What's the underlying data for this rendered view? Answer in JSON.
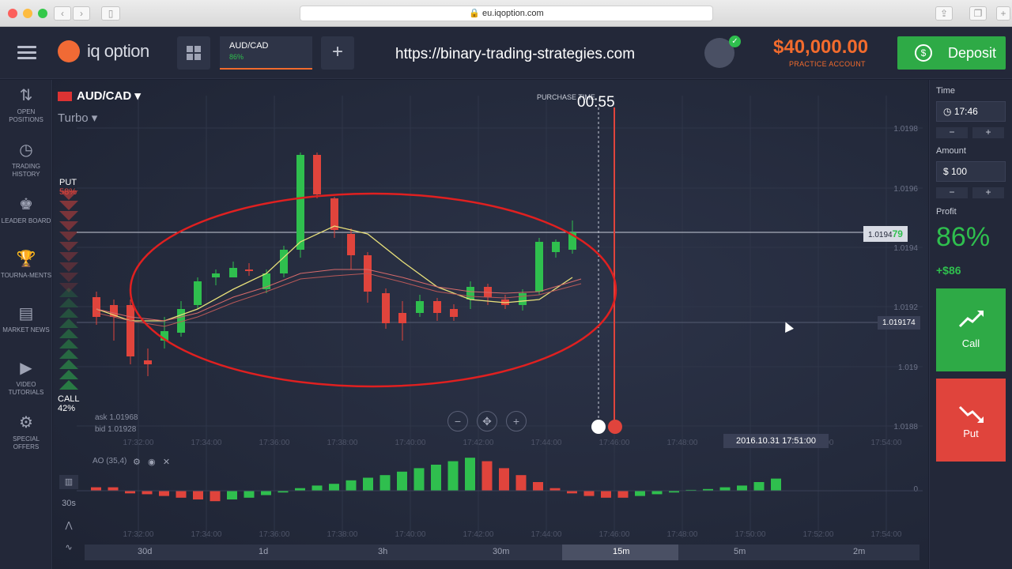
{
  "browser": {
    "url": "eu.iqoption.com"
  },
  "header": {
    "logo": "iq option",
    "asset_tab": {
      "name": "AUD/CAD",
      "pct": "86%"
    },
    "plus": "+",
    "watermark_url": "https://binary-trading-strategies.com",
    "balance": "$40,000.00",
    "balance_sub": "PRACTICE ACCOUNT",
    "deposit": "Deposit"
  },
  "sidebar": {
    "items": [
      {
        "icon": "open-positions-icon",
        "label": "OPEN POSITIONS"
      },
      {
        "icon": "trading-history-icon",
        "label": "TRADING HISTORY"
      },
      {
        "icon": "leaderboard-icon",
        "label": "LEADER BOARD"
      },
      {
        "icon": "tournaments-icon",
        "label": "TOURNA-MENTS"
      },
      {
        "icon": "market-news-icon",
        "label": "MARKET NEWS"
      },
      {
        "icon": "video-tutorials-icon",
        "label": "VIDEO TUTORIALS"
      },
      {
        "icon": "special-offers-icon",
        "label": "SPECIAL OFFERS"
      }
    ]
  },
  "chart": {
    "asset": "AUD/CAD",
    "mode": "Turbo",
    "put_label": "PUT",
    "put_pct": "58%",
    "call_label": "CALL",
    "call_pct": "42%",
    "ask": "ask 1.01968",
    "bid": "bid 1.01928",
    "purchase_label": "PURCHASE TIME",
    "purchase_time": "00:55",
    "current_price": "1.0194",
    "current_price_suffix": "79",
    "strike_price": "1.019174",
    "date_tag": "2016.10.31 17:51:00",
    "ao_label": "AO (35,4)",
    "price_axis": [
      "1.0198",
      "1.0196",
      "1.0194",
      "1.0192",
      "1.019",
      "1.0188"
    ],
    "time_axis": [
      "17:32:00",
      "17:34:00",
      "17:36:00",
      "17:38:00",
      "17:40:00",
      "17:42:00",
      "17:44:00",
      "17:46:00",
      "17:48:00",
      "17:50:00",
      "17:52:00",
      "17:54:00"
    ],
    "ao_zero": "0",
    "timeframes": [
      "30d",
      "1d",
      "3h",
      "30m",
      "15m",
      "5m",
      "2m"
    ],
    "active_timeframe": "15m",
    "tool_interval": "30s",
    "colors": {
      "up": "#2fbf4e",
      "down": "#e0443c",
      "ma": "#e8e07a",
      "annotation": "#e02020"
    }
  },
  "right_panel": {
    "time_label": "Time",
    "time_value": "17:46",
    "amount_label": "Amount",
    "amount_value": "$ 100",
    "profit_label": "Profit",
    "profit_pct": "86%",
    "profit_amount": "+$86",
    "call": "Call",
    "put": "Put",
    "minus": "−",
    "plus": "+"
  }
}
